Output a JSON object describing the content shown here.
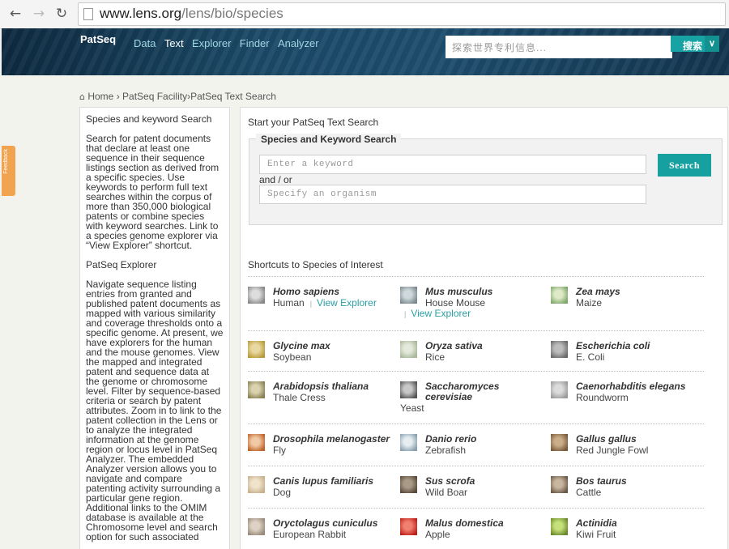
{
  "browser": {
    "url_host": "www.lens.org",
    "url_path": "/lens/bio/species"
  },
  "header": {
    "brand": "PatSeq",
    "nav": [
      "Data",
      "Text",
      "Explorer",
      "Finder",
      "Analyzer"
    ],
    "active_nav": "Text",
    "search_placeholder": "探索世界专利信息...",
    "search_button": "搜索"
  },
  "feedback_label": "Feedback",
  "breadcrumb": {
    "home": "Home",
    "facility": "PatSeq Facility",
    "current": "PatSeq Text Search"
  },
  "left": {
    "heading1": "Species and keyword Search",
    "para1": "Search for patent documents that declare at least one sequence in their sequence listings section as derived from a specific species. Use keywords to perform full text searches within the corpus of more than 350,000 biological patents or combine species with keyword searches. Link to a species genome explorer via “View Explorer” shortcut.",
    "heading2": "PatSeq Explorer",
    "para2": "Navigate sequence listing entries from granted and published patent documents as mapped with various similarity and coverage thresholds onto a specific genome. At present, we have explorers for the human and the mouse genomes. View the mapped and integrated patent and sequence data at the genome or chromosome level. Filter by sequence-based criteria or search by patent attributes. Zoom in to link to the patent collection in the Lens or to analyze the integrated information at the genome region or locus level in PatSeq Analyzer. The embedded Analyzer version allows you to navigate and compare patenting activity surrounding a particular gene region. Additional links to the OMIM database is available at the Chromosome level and search option for such associated"
  },
  "main": {
    "title": "Start your PatSeq Text Search",
    "legend": "Species and Keyword Search",
    "keyword_placeholder": "Enter a keyword",
    "and_or": "and / or",
    "organism_placeholder": "Specify an organism",
    "search_button": "Search",
    "shortcuts_title": "Shortcuts to Species of Interest",
    "view_explorer": "View Explorer"
  },
  "species": [
    {
      "latin": "Homo sapiens",
      "common": "Human",
      "explorer": true,
      "icon": "human-face-icon"
    },
    {
      "latin": "Mus musculus",
      "common": "House Mouse",
      "explorer": true,
      "icon": "mouse-icon"
    },
    {
      "latin": "Zea mays",
      "common": "Maize",
      "explorer": false,
      "icon": "maize-icon"
    },
    {
      "latin": "Glycine max",
      "common": "Soybean",
      "explorer": false,
      "icon": "soybean-icon"
    },
    {
      "latin": "Oryza sativa",
      "common": "Rice",
      "explorer": false,
      "icon": "rice-icon"
    },
    {
      "latin": "Escherichia coli",
      "common": "E. Coli",
      "explorer": false,
      "icon": "ecoli-icon"
    },
    {
      "latin": "Arabidopsis thaliana",
      "common": "Thale Cress",
      "explorer": false,
      "icon": "thale-cress-icon"
    },
    {
      "latin": "Saccharomyces cerevisiae",
      "common": "Yeast",
      "explorer": false,
      "icon": "yeast-icon"
    },
    {
      "latin": "Caenorhabditis elegans",
      "common": "Roundworm",
      "explorer": false,
      "icon": "roundworm-icon"
    },
    {
      "latin": "Drosophila melanogaster",
      "common": "Fly",
      "explorer": false,
      "icon": "fly-icon"
    },
    {
      "latin": "Danio rerio",
      "common": "Zebrafish",
      "explorer": false,
      "icon": "zebrafish-icon"
    },
    {
      "latin": "Gallus gallus",
      "common": "Red Jungle Fowl",
      "explorer": false,
      "icon": "chicken-icon"
    },
    {
      "latin": "Canis lupus familiaris",
      "common": "Dog",
      "explorer": false,
      "icon": "dog-icon"
    },
    {
      "latin": "Sus scrofa",
      "common": "Wild Boar",
      "explorer": false,
      "icon": "boar-icon"
    },
    {
      "latin": "Bos taurus",
      "common": "Cattle",
      "explorer": false,
      "icon": "cattle-icon"
    },
    {
      "latin": "Oryctolagus cuniculus",
      "common": "European Rabbit",
      "explorer": false,
      "icon": "rabbit-icon"
    },
    {
      "latin": "Malus domestica",
      "common": "Apple",
      "explorer": false,
      "icon": "apple-icon"
    },
    {
      "latin": "Actinidia",
      "common": "Kiwi Fruit",
      "explorer": false,
      "icon": "kiwi-icon"
    }
  ],
  "colors": {
    "accent": "#17a0a0",
    "link": "#2a9fa6",
    "header_dark": "#0e2a40",
    "feedback": "#f2a34f"
  }
}
